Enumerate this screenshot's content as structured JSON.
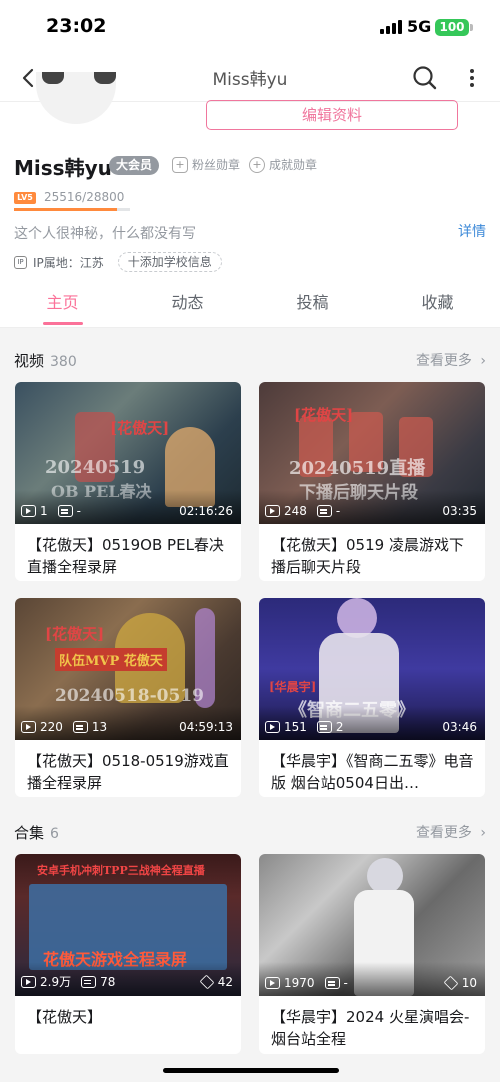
{
  "status": {
    "time": "23:02",
    "network": "5G",
    "battery": "100"
  },
  "nav": {
    "title": "Miss韩yu"
  },
  "profile": {
    "edit_label": "编辑资料",
    "username": "Miss韩yu",
    "vip": "大会员",
    "fan_medal": "粉丝勋章",
    "achievement_medal": "成就勋章",
    "level": "LV5",
    "exp_text": "25516/28800",
    "exp_progress": 0.886,
    "bio": "这个人很神秘，什么都没有写",
    "details": "详情",
    "ip": "IP属地：江苏",
    "add_school": "十添加学校信息"
  },
  "tabs": [
    {
      "label": "主页"
    },
    {
      "label": "动态"
    },
    {
      "label": "投稿"
    },
    {
      "label": "收藏"
    }
  ],
  "videos": {
    "title": "视频",
    "count": "380",
    "more": "查看更多",
    "items": [
      {
        "plays": "1",
        "danmaku": "-",
        "duration": "02:16:26",
        "title": "【花傲天】0519OB PEL春决直播全程录屏",
        "thumb_text_1": "20240519",
        "thumb_text_2": "OB PEL春决",
        "thumb_text_3": "[花傲天]"
      },
      {
        "plays": "248",
        "danmaku": "-",
        "duration": "03:35",
        "title": "【花傲天】0519 凌晨游戏下播后聊天片段",
        "thumb_text_1": "20240519直播",
        "thumb_text_2": "下播后聊天片段",
        "thumb_text_3": "[花傲天]"
      },
      {
        "plays": "220",
        "danmaku": "13",
        "duration": "04:59:13",
        "title": "【花傲天】0518-0519游戏直播全程录屏",
        "thumb_text_1": "20240518-0519",
        "thumb_text_2": "队伍MVP 花傲天",
        "thumb_text_3": "[花傲天]"
      },
      {
        "plays": "151",
        "danmaku": "2",
        "duration": "03:46",
        "title": "【华晨宇】《智商二五零》电音版 烟台站0504日出…",
        "thumb_text_1": "《智商二五零》",
        "thumb_text_2": "[华晨宇]",
        "thumb_text_3": ""
      }
    ]
  },
  "collections": {
    "title": "合集",
    "count": "6",
    "more": "查看更多",
    "items": [
      {
        "plays": "2.9万",
        "danmaku": "78",
        "episodes": "42",
        "title": "【花傲天】",
        "thumb_text_1": "安卓手机冲刺TPP三战神全程直播",
        "thumb_text_2": "花傲天游戏全程录屏"
      },
      {
        "plays": "1970",
        "danmaku": "-",
        "episodes": "10",
        "title": "【华晨宇】2024 火星演唱会-烟台站全程",
        "thumb_text_1": "",
        "thumb_text_2": ""
      }
    ]
  }
}
